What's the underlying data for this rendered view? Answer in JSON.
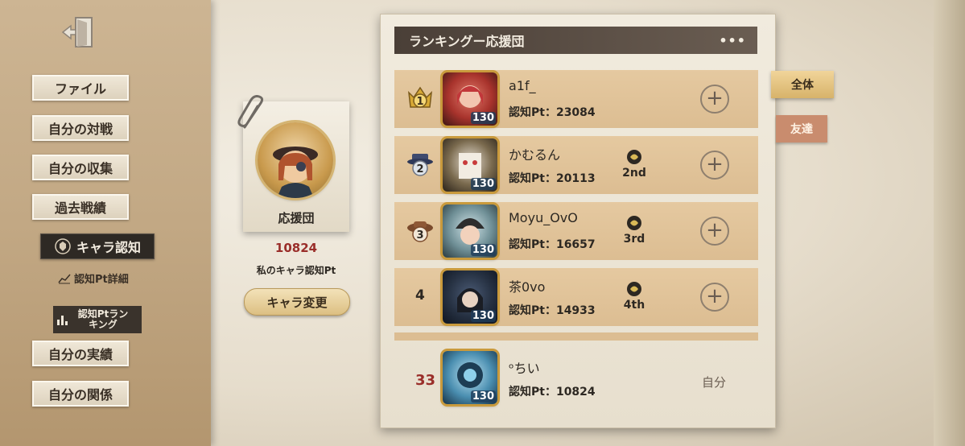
{
  "sidebar": {
    "items": [
      {
        "label": "ファイル"
      },
      {
        "label": "自分の対戦"
      },
      {
        "label": "自分の収集"
      },
      {
        "label": "過去戦績"
      },
      {
        "label": "キャラ認知"
      },
      {
        "label": "認知Pt詳細"
      },
      {
        "label": "認知Ptランキング"
      },
      {
        "label": "自分の実績"
      },
      {
        "label": "自分の関係"
      }
    ]
  },
  "profile": {
    "card_label": "応援団",
    "points": "10824",
    "points_label": "私のキャラ認知Pt",
    "change_button": "キャラ変更"
  },
  "ranking": {
    "title": "ランキングー応援団",
    "more": "•••",
    "rows": [
      {
        "rank": "1",
        "name": "a1f_",
        "pt": "認知Pt：23084",
        "level": "130",
        "tier": ""
      },
      {
        "rank": "2",
        "name": "かむるん",
        "pt": "認知Pt：20113",
        "level": "130",
        "tier": "2nd"
      },
      {
        "rank": "3",
        "name": "Moyu_OvO",
        "pt": "認知Pt：16657",
        "level": "130",
        "tier": "3rd"
      },
      {
        "rank": "4",
        "name": "茶0vo",
        "pt": "認知Pt：14933",
        "level": "130",
        "tier": "4th"
      }
    ],
    "self": {
      "rank": "33",
      "name": "ᵒちい",
      "pt": "認知Pt：10824",
      "level": "130",
      "tag": "自分"
    }
  },
  "tabs": {
    "all": "全体",
    "friends": "友達"
  },
  "colors": {
    "accent_red": "#9a2e2a",
    "row_bg": "#e5c9a0",
    "header_bg": "#4a3f37"
  }
}
